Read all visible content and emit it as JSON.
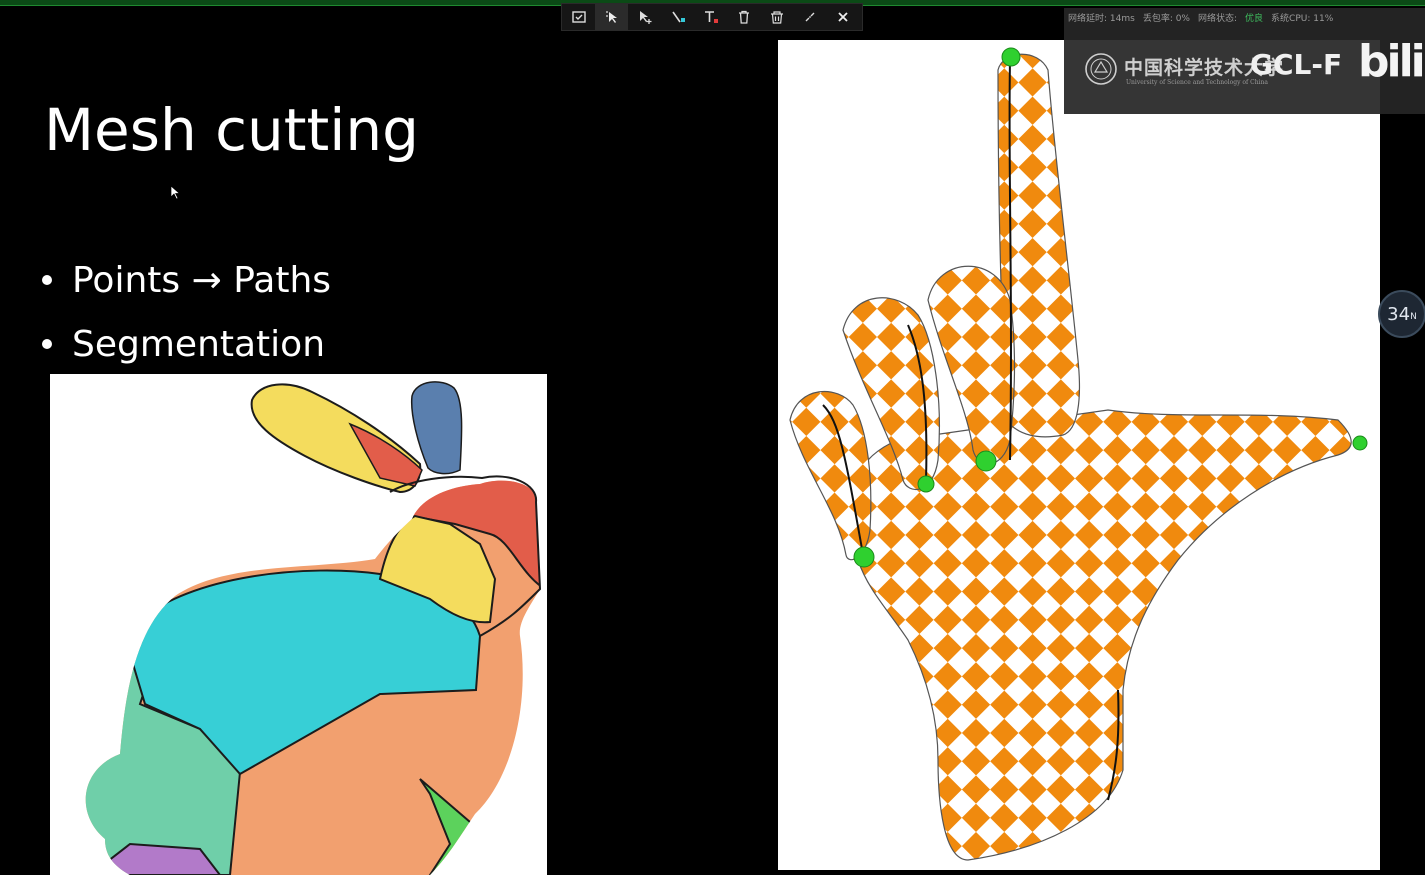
{
  "toolbar": {
    "tools": [
      "select-box",
      "pointer-add",
      "line",
      "text",
      "delete",
      "clear",
      "collapse",
      "close"
    ]
  },
  "slide": {
    "title": "Mesh cutting",
    "bullets": [
      {
        "text": "Points → Paths"
      },
      {
        "text": "Segmentation"
      }
    ]
  },
  "overlay": {
    "latency": "网络延时: 14ms",
    "packet_loss": "丢包率: 0%",
    "network_status_label": "网络状态:",
    "network_status_value": "优良",
    "cpu": "系统CPU: 11%",
    "university_cn": "中国科学技术大学",
    "university_en": "University of Science and Technology of China",
    "lab": "GCL-F",
    "site_logo": "bilibili"
  },
  "page_badge": {
    "number": "34",
    "suffix": "N"
  },
  "colors": {
    "accent_green": "#1f8a30",
    "checker_orange": "#f08a0e",
    "status_ok": "#3fbf5f"
  }
}
